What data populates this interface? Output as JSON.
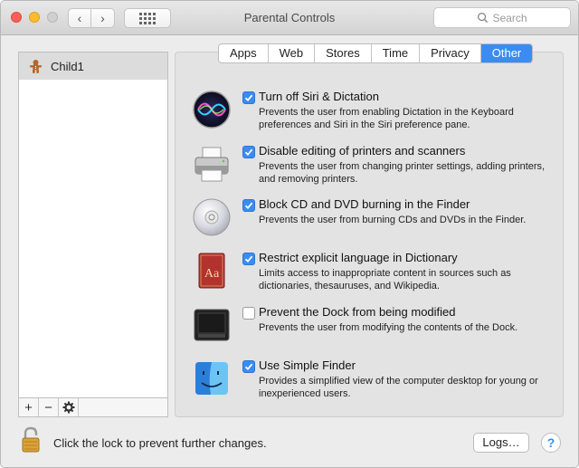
{
  "window": {
    "title": "Parental Controls"
  },
  "search": {
    "placeholder": "Search"
  },
  "sidebar": {
    "items": [
      {
        "label": "Child1",
        "icon": "gingerbread-avatar-icon"
      }
    ]
  },
  "tools": {
    "add": "+",
    "remove": "−",
    "action": "✱"
  },
  "tabs": [
    {
      "label": "Apps",
      "active": false
    },
    {
      "label": "Web",
      "active": false
    },
    {
      "label": "Stores",
      "active": false
    },
    {
      "label": "Time",
      "active": false
    },
    {
      "label": "Privacy",
      "active": false
    },
    {
      "label": "Other",
      "active": true
    }
  ],
  "options": [
    {
      "icon": "siri-icon",
      "checked": true,
      "title": "Turn off Siri & Dictation",
      "desc": "Prevents the user from enabling Dictation in the Keyboard preferences and Siri in the Siri preference pane."
    },
    {
      "icon": "printer-icon",
      "checked": true,
      "title": "Disable editing of printers and scanners",
      "desc": "Prevents the user from changing printer settings, adding printers, and removing printers."
    },
    {
      "icon": "cd-icon",
      "checked": true,
      "title": "Block CD and DVD burning in the Finder",
      "desc": "Prevents the user from burning CDs and DVDs in the Finder."
    },
    {
      "icon": "dictionary-icon",
      "checked": true,
      "title": "Restrict explicit language in Dictionary",
      "desc": "Limits access to inappropriate content in sources such as dictionaries, thesauruses, and Wikipedia."
    },
    {
      "icon": "dock-icon",
      "checked": false,
      "title": "Prevent the Dock from being modified",
      "desc": "Prevents the user from modifying the contents of the Dock."
    },
    {
      "icon": "finder-icon",
      "checked": true,
      "title": "Use Simple Finder",
      "desc": "Provides a simplified view of the computer desktop for young or inexperienced users."
    }
  ],
  "footer": {
    "lock_label": "Click the lock to prevent further changes.",
    "logs_label": "Logs…",
    "help_label": "?"
  },
  "colors": {
    "accent": "#3a8cf3"
  }
}
